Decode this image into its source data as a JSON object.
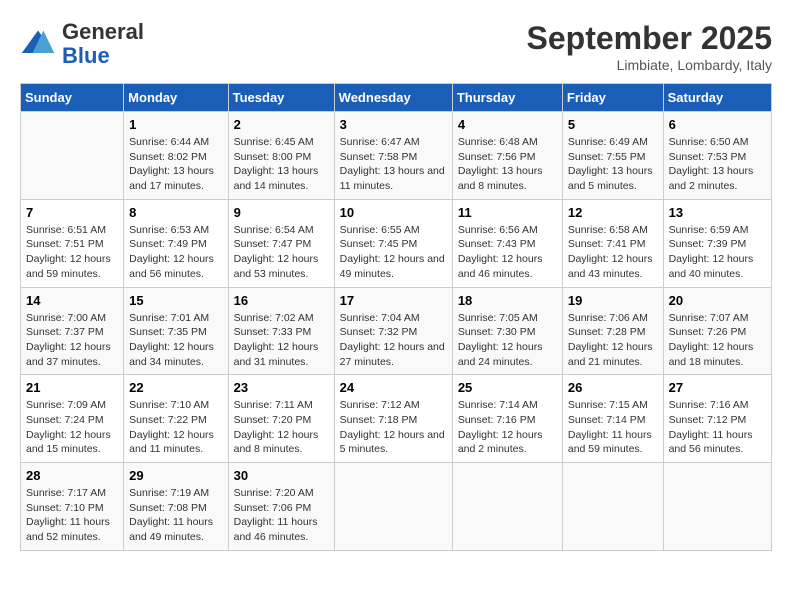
{
  "logo": {
    "general": "General",
    "blue": "Blue"
  },
  "title": "September 2025",
  "location": "Limbiate, Lombardy, Italy",
  "headers": [
    "Sunday",
    "Monday",
    "Tuesday",
    "Wednesday",
    "Thursday",
    "Friday",
    "Saturday"
  ],
  "weeks": [
    [
      {
        "day": "",
        "empty": true
      },
      {
        "day": "1",
        "sunrise": "Sunrise: 6:44 AM",
        "sunset": "Sunset: 8:02 PM",
        "daylight": "Daylight: 13 hours and 17 minutes."
      },
      {
        "day": "2",
        "sunrise": "Sunrise: 6:45 AM",
        "sunset": "Sunset: 8:00 PM",
        "daylight": "Daylight: 13 hours and 14 minutes."
      },
      {
        "day": "3",
        "sunrise": "Sunrise: 6:47 AM",
        "sunset": "Sunset: 7:58 PM",
        "daylight": "Daylight: 13 hours and 11 minutes."
      },
      {
        "day": "4",
        "sunrise": "Sunrise: 6:48 AM",
        "sunset": "Sunset: 7:56 PM",
        "daylight": "Daylight: 13 hours and 8 minutes."
      },
      {
        "day": "5",
        "sunrise": "Sunrise: 6:49 AM",
        "sunset": "Sunset: 7:55 PM",
        "daylight": "Daylight: 13 hours and 5 minutes."
      },
      {
        "day": "6",
        "sunrise": "Sunrise: 6:50 AM",
        "sunset": "Sunset: 7:53 PM",
        "daylight": "Daylight: 13 hours and 2 minutes."
      }
    ],
    [
      {
        "day": "7",
        "sunrise": "Sunrise: 6:51 AM",
        "sunset": "Sunset: 7:51 PM",
        "daylight": "Daylight: 12 hours and 59 minutes."
      },
      {
        "day": "8",
        "sunrise": "Sunrise: 6:53 AM",
        "sunset": "Sunset: 7:49 PM",
        "daylight": "Daylight: 12 hours and 56 minutes."
      },
      {
        "day": "9",
        "sunrise": "Sunrise: 6:54 AM",
        "sunset": "Sunset: 7:47 PM",
        "daylight": "Daylight: 12 hours and 53 minutes."
      },
      {
        "day": "10",
        "sunrise": "Sunrise: 6:55 AM",
        "sunset": "Sunset: 7:45 PM",
        "daylight": "Daylight: 12 hours and 49 minutes."
      },
      {
        "day": "11",
        "sunrise": "Sunrise: 6:56 AM",
        "sunset": "Sunset: 7:43 PM",
        "daylight": "Daylight: 12 hours and 46 minutes."
      },
      {
        "day": "12",
        "sunrise": "Sunrise: 6:58 AM",
        "sunset": "Sunset: 7:41 PM",
        "daylight": "Daylight: 12 hours and 43 minutes."
      },
      {
        "day": "13",
        "sunrise": "Sunrise: 6:59 AM",
        "sunset": "Sunset: 7:39 PM",
        "daylight": "Daylight: 12 hours and 40 minutes."
      }
    ],
    [
      {
        "day": "14",
        "sunrise": "Sunrise: 7:00 AM",
        "sunset": "Sunset: 7:37 PM",
        "daylight": "Daylight: 12 hours and 37 minutes."
      },
      {
        "day": "15",
        "sunrise": "Sunrise: 7:01 AM",
        "sunset": "Sunset: 7:35 PM",
        "daylight": "Daylight: 12 hours and 34 minutes."
      },
      {
        "day": "16",
        "sunrise": "Sunrise: 7:02 AM",
        "sunset": "Sunset: 7:33 PM",
        "daylight": "Daylight: 12 hours and 31 minutes."
      },
      {
        "day": "17",
        "sunrise": "Sunrise: 7:04 AM",
        "sunset": "Sunset: 7:32 PM",
        "daylight": "Daylight: 12 hours and 27 minutes."
      },
      {
        "day": "18",
        "sunrise": "Sunrise: 7:05 AM",
        "sunset": "Sunset: 7:30 PM",
        "daylight": "Daylight: 12 hours and 24 minutes."
      },
      {
        "day": "19",
        "sunrise": "Sunrise: 7:06 AM",
        "sunset": "Sunset: 7:28 PM",
        "daylight": "Daylight: 12 hours and 21 minutes."
      },
      {
        "day": "20",
        "sunrise": "Sunrise: 7:07 AM",
        "sunset": "Sunset: 7:26 PM",
        "daylight": "Daylight: 12 hours and 18 minutes."
      }
    ],
    [
      {
        "day": "21",
        "sunrise": "Sunrise: 7:09 AM",
        "sunset": "Sunset: 7:24 PM",
        "daylight": "Daylight: 12 hours and 15 minutes."
      },
      {
        "day": "22",
        "sunrise": "Sunrise: 7:10 AM",
        "sunset": "Sunset: 7:22 PM",
        "daylight": "Daylight: 12 hours and 11 minutes."
      },
      {
        "day": "23",
        "sunrise": "Sunrise: 7:11 AM",
        "sunset": "Sunset: 7:20 PM",
        "daylight": "Daylight: 12 hours and 8 minutes."
      },
      {
        "day": "24",
        "sunrise": "Sunrise: 7:12 AM",
        "sunset": "Sunset: 7:18 PM",
        "daylight": "Daylight: 12 hours and 5 minutes."
      },
      {
        "day": "25",
        "sunrise": "Sunrise: 7:14 AM",
        "sunset": "Sunset: 7:16 PM",
        "daylight": "Daylight: 12 hours and 2 minutes."
      },
      {
        "day": "26",
        "sunrise": "Sunrise: 7:15 AM",
        "sunset": "Sunset: 7:14 PM",
        "daylight": "Daylight: 11 hours and 59 minutes."
      },
      {
        "day": "27",
        "sunrise": "Sunrise: 7:16 AM",
        "sunset": "Sunset: 7:12 PM",
        "daylight": "Daylight: 11 hours and 56 minutes."
      }
    ],
    [
      {
        "day": "28",
        "sunrise": "Sunrise: 7:17 AM",
        "sunset": "Sunset: 7:10 PM",
        "daylight": "Daylight: 11 hours and 52 minutes."
      },
      {
        "day": "29",
        "sunrise": "Sunrise: 7:19 AM",
        "sunset": "Sunset: 7:08 PM",
        "daylight": "Daylight: 11 hours and 49 minutes."
      },
      {
        "day": "30",
        "sunrise": "Sunrise: 7:20 AM",
        "sunset": "Sunset: 7:06 PM",
        "daylight": "Daylight: 11 hours and 46 minutes."
      },
      {
        "day": "",
        "empty": true
      },
      {
        "day": "",
        "empty": true
      },
      {
        "day": "",
        "empty": true
      },
      {
        "day": "",
        "empty": true
      }
    ]
  ]
}
